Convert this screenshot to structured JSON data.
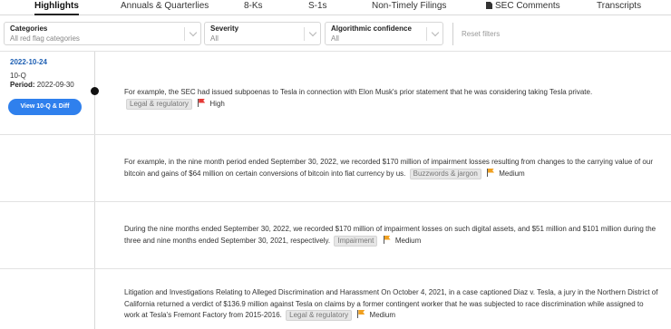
{
  "tabs": [
    {
      "label": "Highlights",
      "active": true
    },
    {
      "label": "Annuals & Quarterlies"
    },
    {
      "label": "8-Ks"
    },
    {
      "label": "S-1s"
    },
    {
      "label": "Non-Timely Filings"
    },
    {
      "label": "SEC Comments",
      "icon": "document-icon"
    },
    {
      "label": "Transcripts"
    }
  ],
  "filters": {
    "categories": {
      "label": "Categories",
      "value": "All red flag categories"
    },
    "severity": {
      "label": "Severity",
      "value": "All"
    },
    "confidence": {
      "label": "Algorithmic confidence",
      "value": "All"
    },
    "reset_label": "Reset filters"
  },
  "filing": {
    "date": "2022-10-24",
    "form": "10-Q",
    "period_label": "Period:",
    "period_value": "2022-09-30",
    "button_label": "View 10-Q & Diff"
  },
  "entries": [
    {
      "text": "For example, the SEC had issued subpoenas to Tesla in connection with Elon Musk's prior statement that he was considering taking Tesla private.",
      "tag": "Legal & regulatory",
      "severity": "High",
      "flag_color": "#e53935"
    },
    {
      "text": "For example, in the nine month period ended September 30, 2022, we recorded $170 million of impairment losses resulting from changes to the carrying value of our bitcoin and gains of $64 million on certain conversions of bitcoin into fiat currency by us.",
      "tag": "Buzzwords & jargon",
      "severity": "Medium",
      "flag_color": "#f0a020"
    },
    {
      "text": "During the nine months ended September 30, 2022, we recorded $170 million of impairment losses on such digital assets, and $51 million and $101 million during the three and nine months ended September 30, 2021, respectively.",
      "tag": "Impairment",
      "severity": "Medium",
      "flag_color": "#f0a020"
    },
    {
      "text": "Litigation and Investigations Relating to Alleged Discrimination and Harassment On October 4, 2021, in a case captioned Diaz v. Tesla, a jury in the Northern District of California returned a verdict of $136.9 million against Tesla on claims by a former contingent worker that he was subjected to race discrimination while assigned to work at Tesla's Fremont Factory from 2015-2016.",
      "tag": "Legal & regulatory",
      "severity": "Medium",
      "flag_color": "#f0a020"
    }
  ]
}
